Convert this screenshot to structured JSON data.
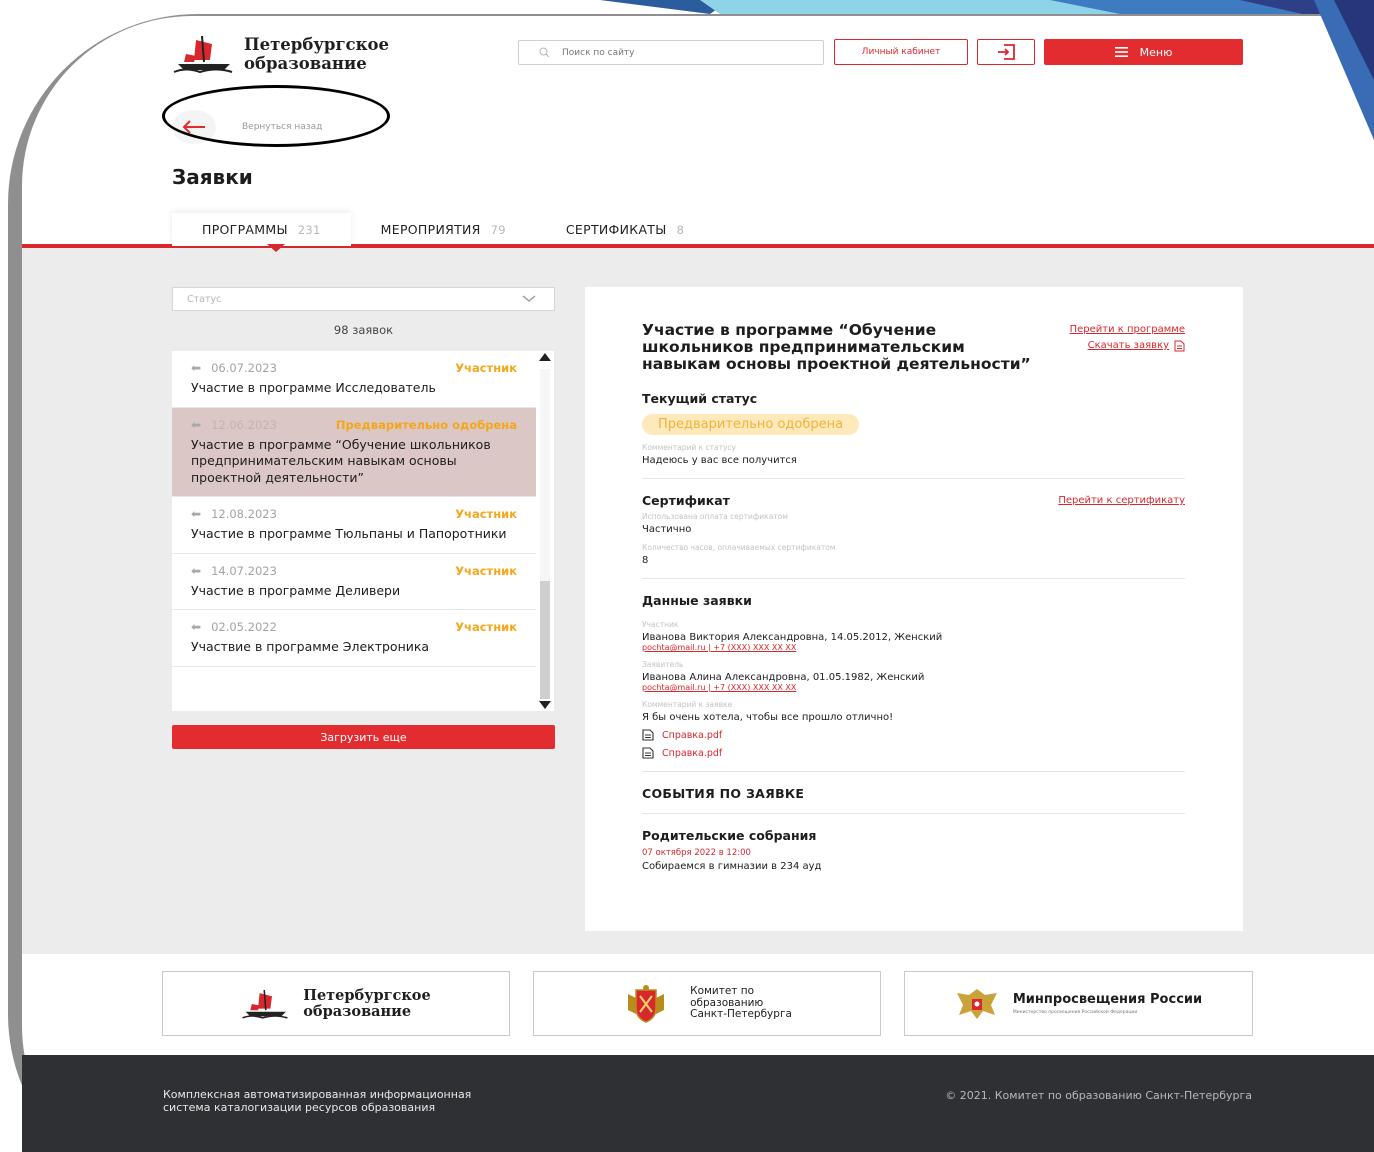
{
  "header": {
    "logo_line1": "Петербургское",
    "logo_line2": "образование",
    "search_placeholder": "Поиск по сайту",
    "cabinet_label": "Личный кабинет",
    "menu_label": "Меню"
  },
  "back_label": "Вернуться назад",
  "page_title": "Заявки",
  "tabs": [
    {
      "label": "ПРОГРАММЫ",
      "count": "231"
    },
    {
      "label": "МЕРОПРИЯТИЯ",
      "count": "79"
    },
    {
      "label": "СЕРТИФИКАТЫ",
      "count": "8"
    }
  ],
  "filter": {
    "status_placeholder": "Статус",
    "count_text": "98 заявок"
  },
  "list": [
    {
      "date": "06.07.2023",
      "status": "Участник",
      "title": "Участие в программе Исследователь"
    },
    {
      "date": "12.06.2023",
      "status": "Предварительно одобрена",
      "title": "Участие в программе “Обучение школьников предпринимательским навыкам основы проектной деятельности”"
    },
    {
      "date": "12.08.2023",
      "status": "Участник",
      "title": "Участие в программе Тюльпаны и Папоротники"
    },
    {
      "date": "14.07.2023",
      "status": "Участник",
      "title": "Участие в программе Деливери"
    },
    {
      "date": "02.05.2022",
      "status": "Участник",
      "title": "Участвие в программе Электроника"
    }
  ],
  "load_more_label": "Загрузить еще",
  "detail": {
    "title": "Участие в программе “Обучение школьников предпринимательским навыкам основы проектной деятельности”",
    "link_program": "Перейти к программе",
    "link_download": "Скачать заявку",
    "status_heading": "Текущий статус",
    "status_value": "Предварительно одобрена",
    "status_comment_label": "Комментарий к статусу",
    "status_comment": "Надеюсь у вас все получится",
    "cert_heading": "Сертификат",
    "cert_link": "Перейти к сертификату",
    "cert_payment_label": "Использована оплата сертификатом",
    "cert_payment_value": "Частично",
    "cert_hours_label": "Количество часов, оплачиваемых сертификатом",
    "cert_hours_value": "8",
    "data_heading": "Данные заявки",
    "participant_label": "Участник",
    "participant_value": "Иванова Виктория Александровна, 14.05.2012, Женский",
    "participant_contact": "pochta@mail.ru | +7 (XXX) XXX XX XX",
    "applicant_label": "Заявитель",
    "applicant_value": "Иванова Алина Александровна, 01.05.1982, Женский",
    "applicant_contact": "pochta@mail.ru | +7 (XXX) XXX XX XX",
    "app_comment_label": "Комментарий к заявке",
    "app_comment": "Я бы очень хотела, чтобы все прошло отлично!",
    "files": [
      "Справка.pdf",
      "Справка.pdf"
    ],
    "events_heading": "СОБЫТИЯ ПО ЗАЯВКЕ",
    "event_title": "Родительские собрания",
    "event_date": "07 октября 2022 в 12:00",
    "event_desc": "Собираемся в гимназии в 234 ауд"
  },
  "partners": {
    "p1_line1": "Петербургское",
    "p1_line2": "образование",
    "p2_line1": "Комитет по",
    "p2_line2": "образованию",
    "p2_line3": "Санкт-Петербурга",
    "p3_title": "Минпросвещения России",
    "p3_sub": "Министерство просвещения Российской Федерации"
  },
  "footer": {
    "left_line1": "Комплексная автоматизированная информационная",
    "left_line2": "система каталогизации ресурсов образования",
    "right": "© 2021. Комитет по образованию Санкт-Петербурга"
  },
  "colors": {
    "accent": "#e22c2f",
    "status_participant": "#f3a719",
    "status_pending_bg": "#fde9b9",
    "selected_row": "#dbc7c6",
    "footer_bg": "#2e3034"
  }
}
